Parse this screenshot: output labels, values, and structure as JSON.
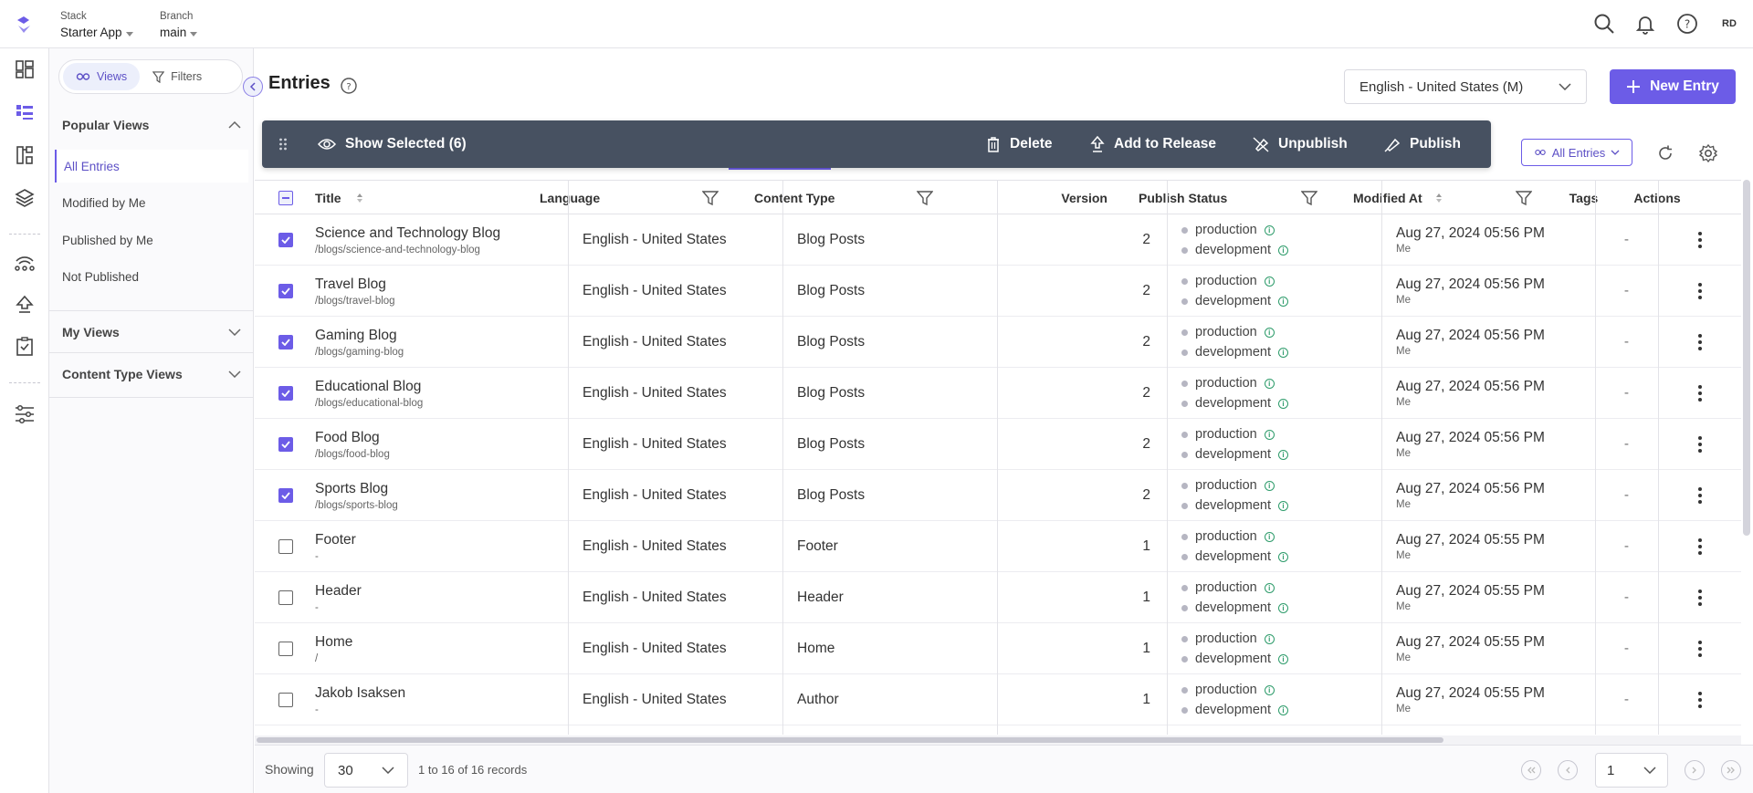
{
  "header": {
    "stack_label": "Stack",
    "stack_value": "Starter App",
    "branch_label": "Branch",
    "branch_value": "main",
    "avatar_initials": "RD",
    "icons": [
      "search-icon",
      "bell-icon",
      "help-icon"
    ]
  },
  "rail": {
    "items": [
      "dashboard-icon",
      "entries-icon",
      "content-models-icon",
      "assets-icon",
      "releases-icon",
      "deploy-icon",
      "tasks-icon",
      "settings-icon"
    ]
  },
  "views_panel": {
    "tab_views": "Views",
    "tab_filters": "Filters",
    "popular_views_title": "Popular Views",
    "popular_views": [
      "All Entries",
      "Modified by Me",
      "Published by Me",
      "Not Published"
    ],
    "my_views_title": "My Views",
    "content_type_views_title": "Content Type Views"
  },
  "main": {
    "title": "Entries",
    "language_select": "English - United States (M)",
    "new_entry_label": "New Entry",
    "all_entries_filter": "All Entries"
  },
  "bulk_bar": {
    "show_selected": "Show Selected (6)",
    "delete": "Delete",
    "add_to_release": "Add to Release",
    "unpublish": "Unpublish",
    "publish": "Publish"
  },
  "table": {
    "columns": [
      "Title",
      "Language",
      "Content Type",
      "Version",
      "Publish Status",
      "Modified At",
      "Tags",
      "Actions"
    ],
    "rows": [
      {
        "title": "Science and Technology Blog",
        "url": "/blogs/science-and-technology-blog",
        "language": "English - United States",
        "content_type": "Blog Posts",
        "version": "2",
        "status": [
          "production",
          "development"
        ],
        "modified": "Aug 27, 2024 05:56 PM",
        "by": "Me",
        "tags": "-",
        "checked": true
      },
      {
        "title": "Travel Blog",
        "url": "/blogs/travel-blog",
        "language": "English - United States",
        "content_type": "Blog Posts",
        "version": "2",
        "status": [
          "production",
          "development"
        ],
        "modified": "Aug 27, 2024 05:56 PM",
        "by": "Me",
        "tags": "-",
        "checked": true
      },
      {
        "title": "Gaming Blog",
        "url": "/blogs/gaming-blog",
        "language": "English - United States",
        "content_type": "Blog Posts",
        "version": "2",
        "status": [
          "production",
          "development"
        ],
        "modified": "Aug 27, 2024 05:56 PM",
        "by": "Me",
        "tags": "-",
        "checked": true
      },
      {
        "title": "Educational Blog",
        "url": "/blogs/educational-blog",
        "language": "English - United States",
        "content_type": "Blog Posts",
        "version": "2",
        "status": [
          "production",
          "development"
        ],
        "modified": "Aug 27, 2024 05:56 PM",
        "by": "Me",
        "tags": "-",
        "checked": true
      },
      {
        "title": "Food Blog",
        "url": "/blogs/food-blog",
        "language": "English - United States",
        "content_type": "Blog Posts",
        "version": "2",
        "status": [
          "production",
          "development"
        ],
        "modified": "Aug 27, 2024 05:56 PM",
        "by": "Me",
        "tags": "-",
        "checked": true
      },
      {
        "title": "Sports Blog",
        "url": "/blogs/sports-blog",
        "language": "English - United States",
        "content_type": "Blog Posts",
        "version": "2",
        "status": [
          "production",
          "development"
        ],
        "modified": "Aug 27, 2024 05:56 PM",
        "by": "Me",
        "tags": "-",
        "checked": true
      },
      {
        "title": "Footer",
        "url": "-",
        "language": "English - United States",
        "content_type": "Footer",
        "version": "1",
        "status": [
          "production",
          "development"
        ],
        "modified": "Aug 27, 2024 05:55 PM",
        "by": "Me",
        "tags": "-",
        "checked": false
      },
      {
        "title": "Header",
        "url": "-",
        "language": "English - United States",
        "content_type": "Header",
        "version": "1",
        "status": [
          "production",
          "development"
        ],
        "modified": "Aug 27, 2024 05:55 PM",
        "by": "Me",
        "tags": "-",
        "checked": false
      },
      {
        "title": "Home",
        "url": "/",
        "language": "English - United States",
        "content_type": "Home",
        "version": "1",
        "status": [
          "production",
          "development"
        ],
        "modified": "Aug 27, 2024 05:55 PM",
        "by": "Me",
        "tags": "-",
        "checked": false
      },
      {
        "title": "Jakob Isaksen",
        "url": "-",
        "language": "English - United States",
        "content_type": "Author",
        "version": "1",
        "status": [
          "production",
          "development"
        ],
        "modified": "Aug 27, 2024 05:55 PM",
        "by": "Me",
        "tags": "-",
        "checked": false
      }
    ]
  },
  "footer": {
    "showing_label": "Showing",
    "page_size": "30",
    "records_text": "1 to 16 of 16 records",
    "current_page": "1"
  },
  "colors": {
    "accent": "#6c5ce7",
    "bulk_bar": "#475161",
    "info_green": "#2e9c6b"
  }
}
